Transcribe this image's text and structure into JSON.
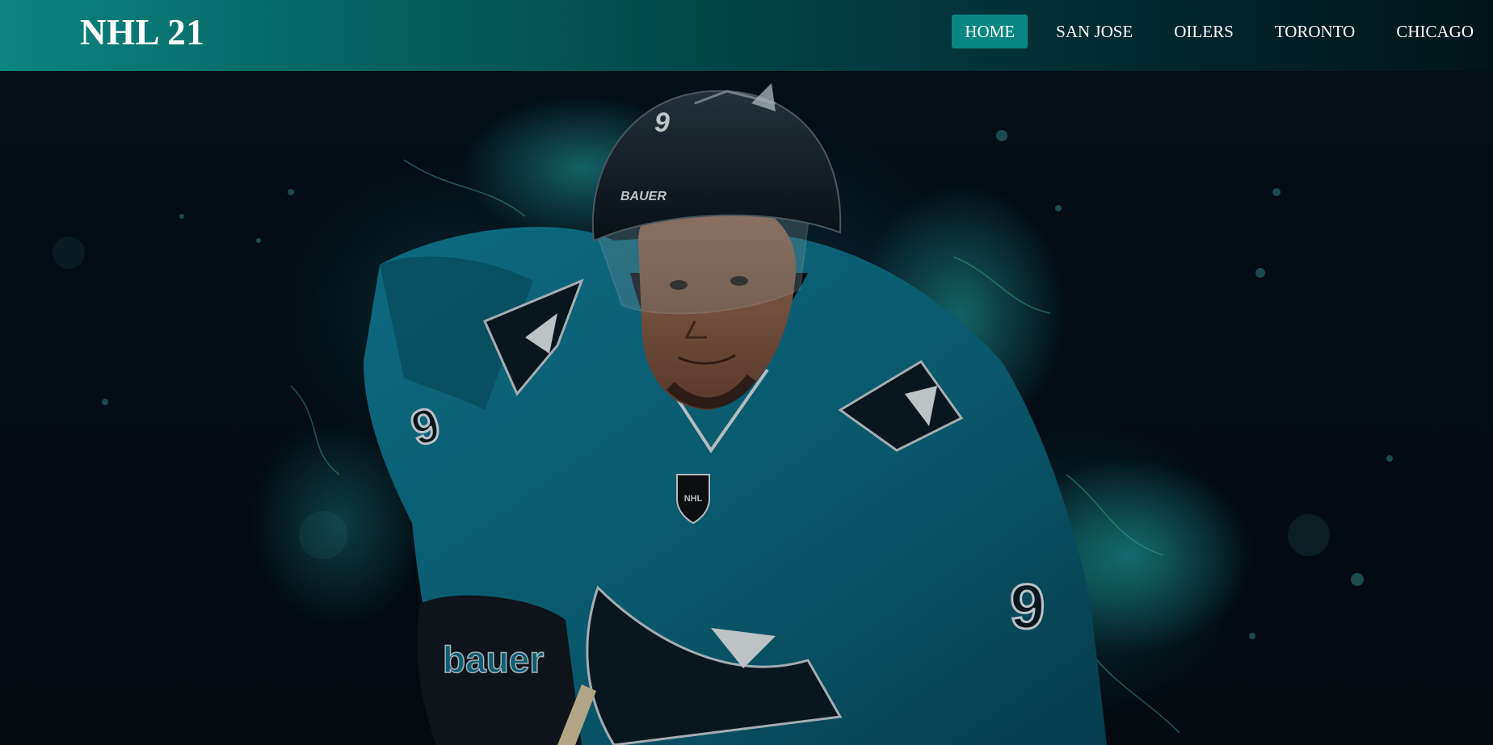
{
  "brand": {
    "title": "NHL 21"
  },
  "nav": {
    "items": [
      {
        "label": "HOME",
        "active": true
      },
      {
        "label": "SAN JOSE",
        "active": false
      },
      {
        "label": "OILERS",
        "active": false
      },
      {
        "label": "TORONTO",
        "active": false
      },
      {
        "label": "CHICAGO",
        "active": false
      }
    ]
  },
  "hero": {
    "helmet_brand": "BAUER",
    "glove_brand": "bauer",
    "jersey_number": "9",
    "league_logo": "NHL"
  },
  "colors": {
    "accent": "#0a8684",
    "jersey_teal": "#0e6f87",
    "background": "#050d14"
  }
}
